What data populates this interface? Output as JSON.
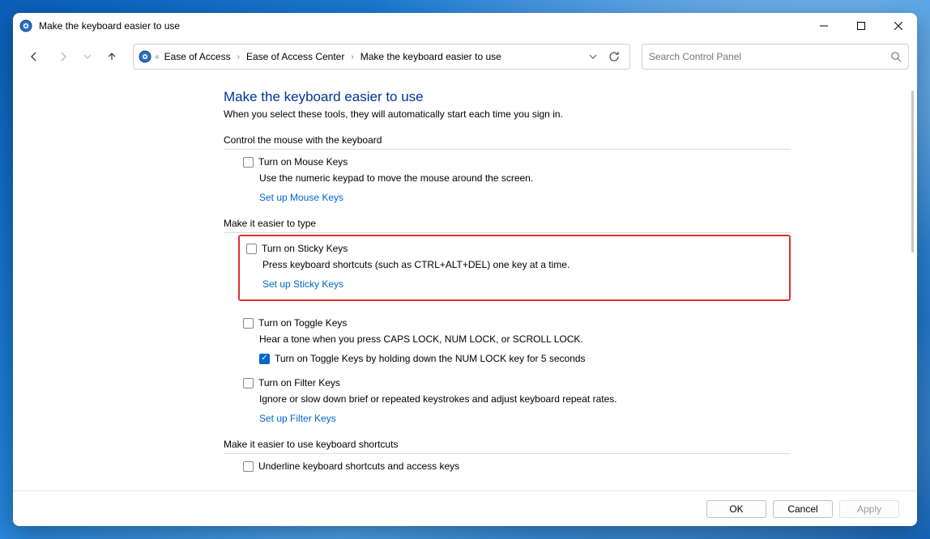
{
  "window": {
    "title": "Make the keyboard easier to use"
  },
  "breadcrumb": {
    "items": [
      "Ease of Access",
      "Ease of Access Center",
      "Make the keyboard easier to use"
    ]
  },
  "search": {
    "placeholder": "Search Control Panel"
  },
  "page": {
    "heading": "Make the keyboard easier to use",
    "subheading": "When you select these tools, they will automatically start each time you sign in."
  },
  "sections": {
    "mouse": {
      "title": "Control the mouse with the keyboard",
      "opt_label": "Turn on Mouse Keys",
      "opt_desc": "Use the numeric keypad to move the mouse around the screen.",
      "link": "Set up Mouse Keys"
    },
    "type": {
      "title": "Make it easier to type",
      "sticky_label": "Turn on Sticky Keys",
      "sticky_desc": "Press keyboard shortcuts (such as CTRL+ALT+DEL) one key at a time.",
      "sticky_link": "Set up Sticky Keys",
      "toggle_label": "Turn on Toggle Keys",
      "toggle_desc": "Hear a tone when you press CAPS LOCK, NUM LOCK, or SCROLL LOCK.",
      "toggle_hold_label": "Turn on Toggle Keys by holding down the NUM LOCK key for 5 seconds",
      "filter_label": "Turn on Filter Keys",
      "filter_desc": "Ignore or slow down brief or repeated keystrokes and adjust keyboard repeat rates.",
      "filter_link": "Set up Filter Keys"
    },
    "shortcuts": {
      "title": "Make it easier to use keyboard shortcuts",
      "underline_label": "Underline keyboard shortcuts and access keys"
    }
  },
  "footer": {
    "ok": "OK",
    "cancel": "Cancel",
    "apply": "Apply"
  }
}
